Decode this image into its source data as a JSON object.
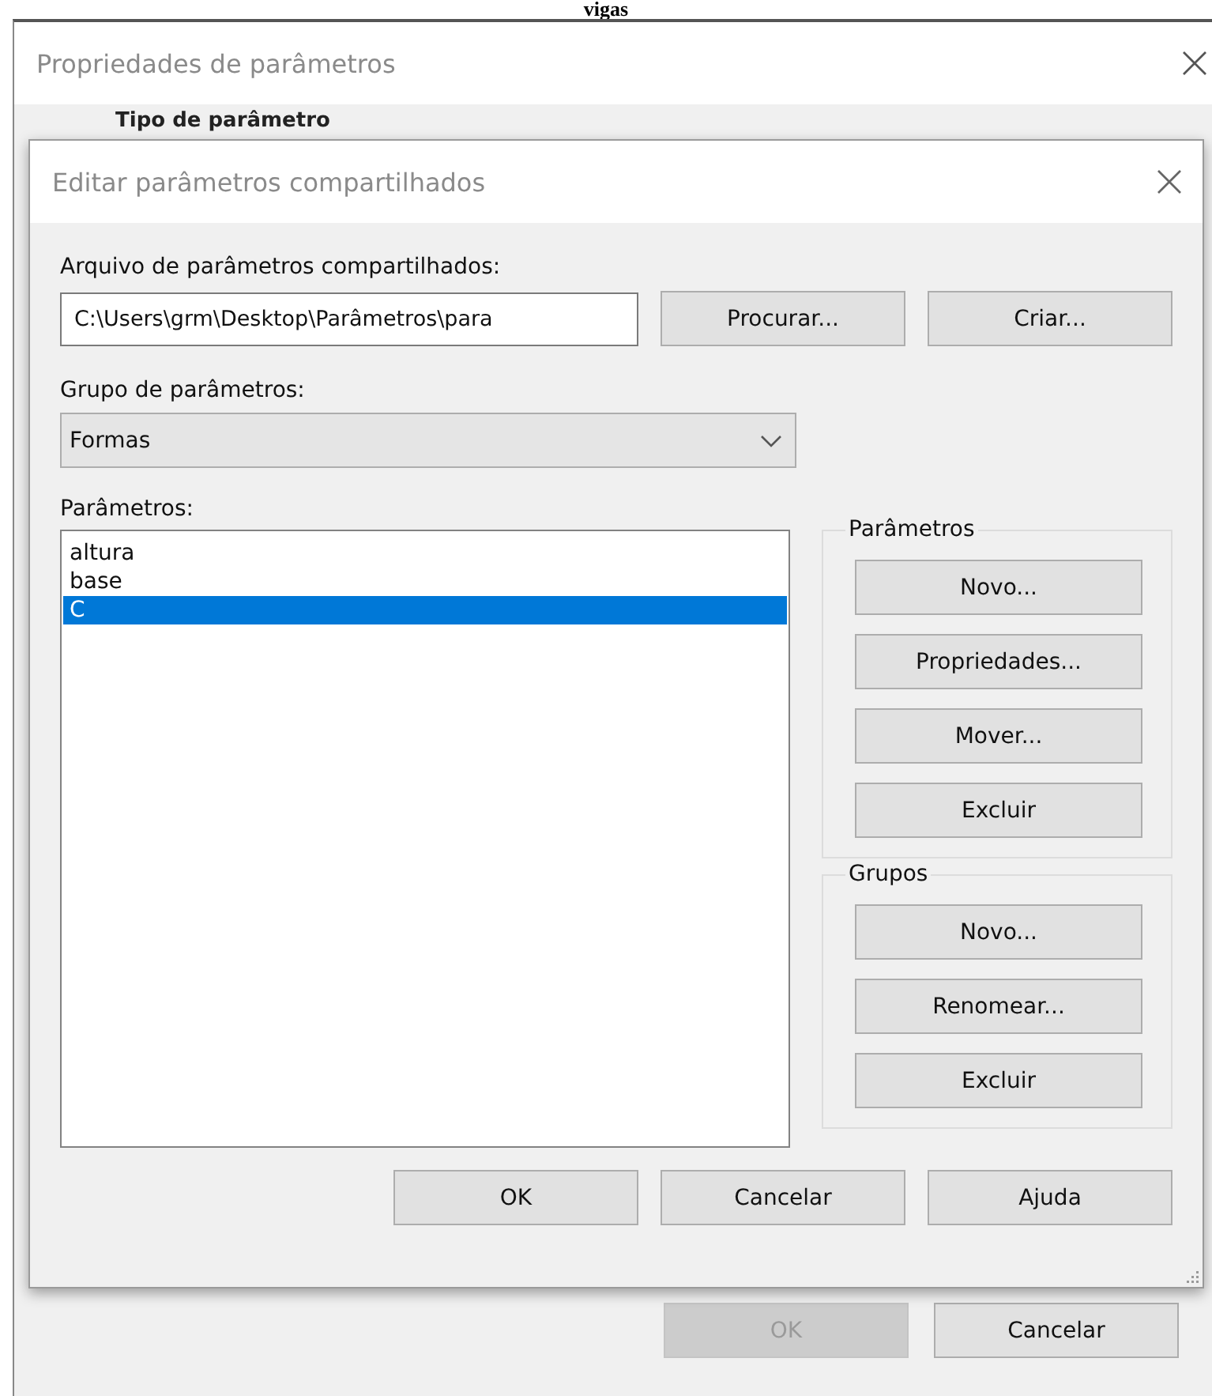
{
  "caption": "vigas",
  "outer_window": {
    "title": "Propriedades de parâmetros",
    "section_label": "Tipo de parâmetro",
    "buttons": [
      {
        "label": "OK",
        "disabled": true
      },
      {
        "label": "Cancelar",
        "disabled": false
      }
    ]
  },
  "dialog": {
    "title": "Editar parâmetros compartilhados",
    "file_label": "Arquivo de parâmetros compartilhados:",
    "file_path": "C:\\Users\\grm\\Desktop\\Parâmetros\\para",
    "file_buttons": [
      "Procurar...",
      "Criar..."
    ],
    "group_label": "Grupo de parâmetros:",
    "group_value": "Formas",
    "params_label": "Parâmetros:",
    "params": [
      {
        "name": "altura",
        "selected": false
      },
      {
        "name": "base",
        "selected": false
      },
      {
        "name": "C",
        "selected": true
      }
    ],
    "boxes": [
      {
        "title": "Parâmetros",
        "buttons": [
          "Novo...",
          "Propriedades...",
          "Mover...",
          "Excluir"
        ]
      },
      {
        "title": "Grupos",
        "buttons": [
          "Novo...",
          "Renomear...",
          "Excluir"
        ]
      }
    ],
    "footer_buttons": [
      "OK",
      "Cancelar",
      "Ajuda"
    ]
  }
}
